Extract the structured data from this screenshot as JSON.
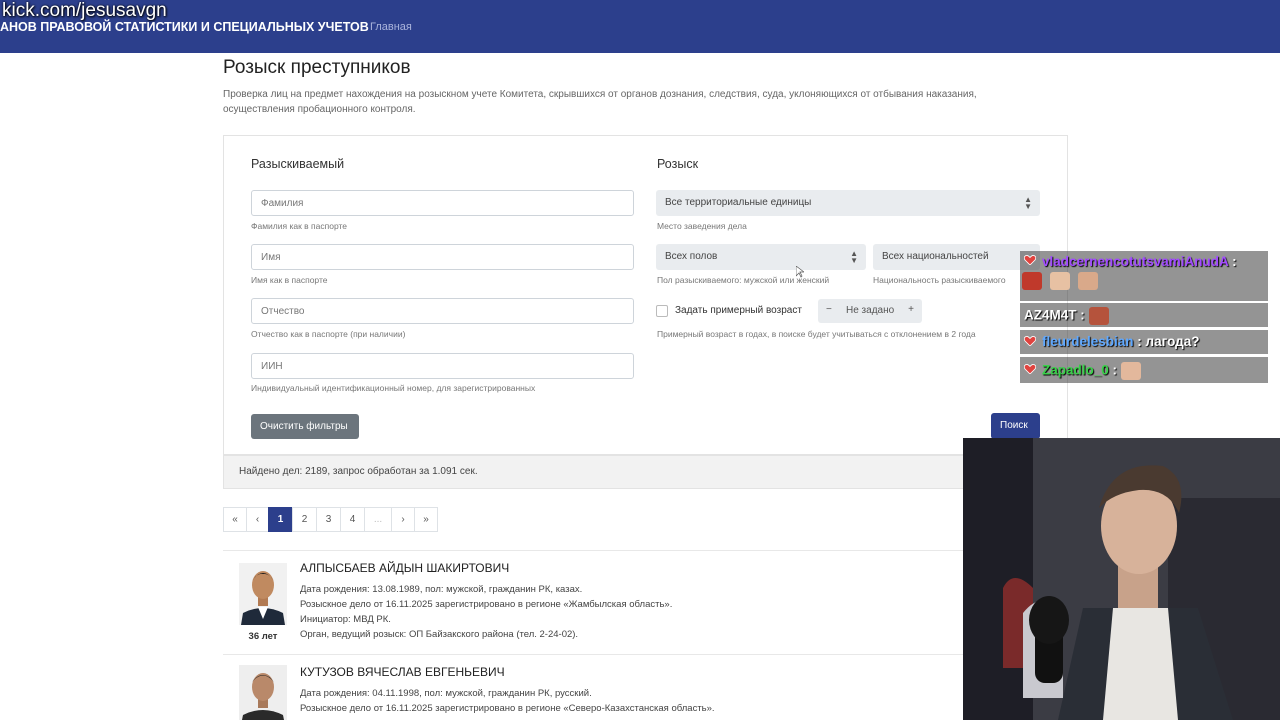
{
  "overlay": {
    "stream_url": "kick.com/jesusavgn"
  },
  "header": {
    "brand": "АНОВ ПРАВОВОЙ СТАТИСТИКИ И СПЕЦИАЛЬНЫХ УЧЕТОВ",
    "nav_home": "Главная"
  },
  "page": {
    "title": "Розыск преступников",
    "description": "Проверка лиц на предмет нахождения на розыскном учете Комитета, скрывшихся от органов дознания, следствия, суда, уклоняющихся от отбывания наказания, осуществления пробационного контроля."
  },
  "form": {
    "wanted_title": "Разыскиваемый",
    "search_title": "Розыск",
    "surname": {
      "placeholder": "Фамилия",
      "help": "Фамилия как в паспорте"
    },
    "firstname": {
      "placeholder": "Имя",
      "help": "Имя как в паспорте"
    },
    "patronymic": {
      "placeholder": "Отчество",
      "help": "Отчество как в паспорте (при наличии)"
    },
    "iin": {
      "placeholder": "ИИН",
      "help": "Индивидуальный идентификационный номер, для зарегистрированных"
    },
    "territory": {
      "value": "Все территориальные единицы",
      "help": "Место заведения дела"
    },
    "gender": {
      "value": "Всех полов",
      "help": "Пол разыскиваемого: мужской или женский"
    },
    "nationality": {
      "value": "Всех национальностей",
      "help": "Национальность разыскиваемого"
    },
    "age": {
      "label": "Задать примерный возраст",
      "stepper_value": "Не задано",
      "minus": "−",
      "plus": "+",
      "help": "Примерный возраст в годах, в поиске будет учитываться с отклонением в 2 года"
    },
    "clear_button": "Очистить фильтры",
    "search_button": "Поиск"
  },
  "results": {
    "summary": "Найдено дел: 2189, запрос обработан за 1.091 сек."
  },
  "pagination": [
    "«",
    "‹",
    "1",
    "2",
    "3",
    "4",
    "...",
    "›",
    "»"
  ],
  "people": [
    {
      "name": "АЛПЫСБАЕВ АЙДЫН ШАКИРТОВИЧ",
      "age": "36 лет",
      "details": [
        "Дата рождения: 13.08.1989, пол: мужской, гражданин РК, казах.",
        "Розыскное дело от 16.11.2025 зарегистрировано в регионе «Жамбылская область».",
        "Инициатор: МВД РК.",
        "Орган, ведущий розыск: ОП Байзакского района (тел. 2-24-02)."
      ]
    },
    {
      "name": "КУТУЗОВ ВЯЧЕСЛАВ ЕВГЕНЬЕВИЧ",
      "details": [
        "Дата рождения: 04.11.1998, пол: мужской, гражданин РК, русский.",
        "Розыскное дело от 16.11.2025 зарегистрировано в регионе «Северо-Казахстанская область»."
      ]
    }
  ],
  "chat": [
    {
      "user": "vladcernencotutsvamiAnudA",
      "text": ":",
      "color": "#a24bff"
    },
    {
      "user": "AZ4M4T",
      "text": ":",
      "color": "#ffffff"
    },
    {
      "user": "fleurdelesbian",
      "text": ": лагода?",
      "color": "#5fa8ff"
    },
    {
      "user": "Zapadlo_0",
      "text": ":",
      "color": "#3ad14a"
    }
  ]
}
